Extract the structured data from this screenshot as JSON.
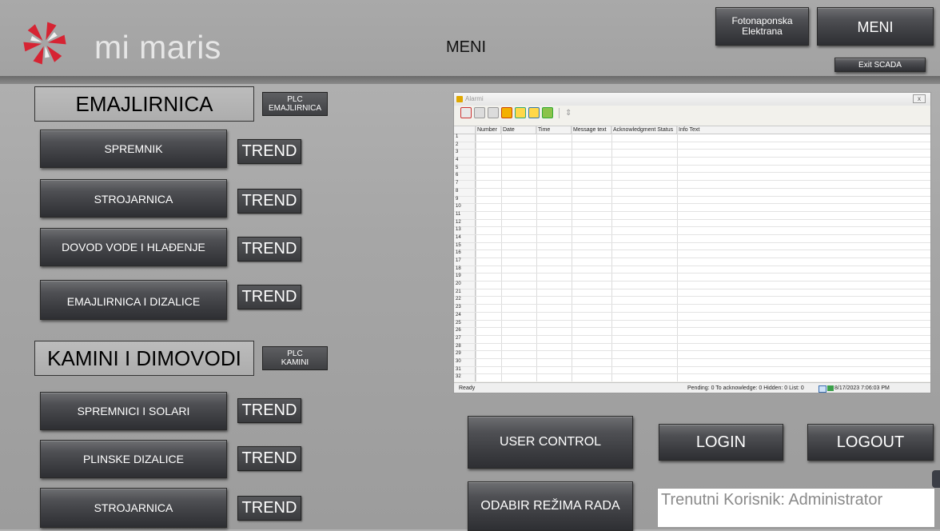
{
  "header": {
    "logo_text": "mi maris",
    "page_title": "MENI",
    "fotonaponska_label_line1": "Fotonaponska",
    "fotonaponska_label_line2": "Elektrana",
    "meni_button": "MENI",
    "exit_button": "Exit SCADA"
  },
  "sections": {
    "emajlirnica": {
      "title": "EMAJLIRNICA",
      "plc_line1": "PLC",
      "plc_line2": "EMAJLIRNICA",
      "items": [
        {
          "label": "SPREMNIK",
          "trend": "TREND"
        },
        {
          "label": "STROJARNICA",
          "trend": "TREND"
        },
        {
          "label": "DOVOD VODE I HLAĐENJE",
          "trend": "TREND"
        },
        {
          "label": "EMAJLIRNICA I DIZALICE",
          "trend": "TREND"
        }
      ]
    },
    "kamini": {
      "title": "KAMINI I DIMOVODI",
      "plc_line1": "PLC",
      "plc_line2": "KAMINI",
      "items": [
        {
          "label": "SPREMNICI I SOLARI",
          "trend": "TREND"
        },
        {
          "label": "PLINSKE DIZALICE",
          "trend": "TREND"
        },
        {
          "label": "STROJARNICA",
          "trend": "TREND"
        }
      ]
    }
  },
  "alarm_window": {
    "title": "Alarmi",
    "close_label": "x",
    "columns": [
      "Number",
      "Date",
      "Time",
      "Message text",
      "Acknowledgment Status",
      "Info Text"
    ],
    "row_count": 32,
    "status_ready": "Ready",
    "status_counts": "Pending: 0   To acknowledge: 0   Hidden: 0   List: 0",
    "status_datetime": "8/17/2023   7:06:03 PM"
  },
  "controls": {
    "user_control": "USER CONTROL",
    "login": "LOGIN",
    "logout": "LOGOUT",
    "mode_select": "ODABIR REŽIMA RADA",
    "current_user": "Trenutni Korisnik: Administrator"
  },
  "colors": {
    "background": "#a6a6a6",
    "button_dark": "#3b3c40",
    "text_light": "#ffffff"
  }
}
